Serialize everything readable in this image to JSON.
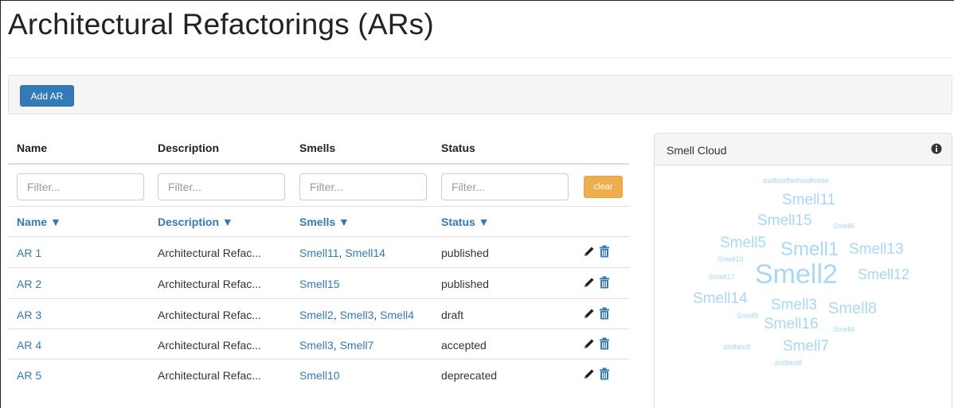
{
  "page": {
    "title": "Architectural Refactorings (ARs)"
  },
  "toolbar": {
    "add_label": "Add AR"
  },
  "table": {
    "headers": {
      "name": "Name",
      "description": "Description",
      "smells": "Smells",
      "status": "Status"
    },
    "filter_placeholder": "Filter...",
    "clear_label": "clear",
    "sort_labels": {
      "name": "Name ▼",
      "description": "Description ▼",
      "smells": "Smells ▼",
      "status": "Status ▼"
    },
    "rows": [
      {
        "name": "AR 1",
        "description": "Architectural Refac...",
        "smells": [
          "Smell11",
          "Smell14"
        ],
        "status": "published"
      },
      {
        "name": "AR 2",
        "description": "Architectural Refac...",
        "smells": [
          "Smell15"
        ],
        "status": "published"
      },
      {
        "name": "AR 3",
        "description": "Architectural Refac...",
        "smells": [
          "Smell2",
          "Smell3",
          "Smell4"
        ],
        "status": "draft"
      },
      {
        "name": "AR 4",
        "description": "Architectural Refac...",
        "smells": [
          "Smell3",
          "Smell7"
        ],
        "status": "accepted"
      },
      {
        "name": "AR 5",
        "description": "Architectural Refac...",
        "smells": [
          "Smell10"
        ],
        "status": "deprecated"
      }
    ]
  },
  "smell_cloud": {
    "title": "Smell Cloud",
    "words": [
      {
        "text": "asdfasdfasfasdfeeee",
        "size": 9
      },
      {
        "text": "Smell11",
        "size": 19
      },
      {
        "text": "Smell15",
        "size": 19
      },
      {
        "text": "Smell6",
        "size": 9
      },
      {
        "text": "Smell5",
        "size": 19
      },
      {
        "text": "Smell10",
        "size": 9
      },
      {
        "text": "Smell1",
        "size": 24
      },
      {
        "text": "Smell13",
        "size": 19
      },
      {
        "text": "Smell17",
        "size": 9
      },
      {
        "text": "Smell2",
        "size": 34
      },
      {
        "text": "Smell12",
        "size": 18
      },
      {
        "text": "Smell14",
        "size": 19
      },
      {
        "text": "Smell3",
        "size": 19
      },
      {
        "text": "Smell9",
        "size": 9
      },
      {
        "text": "Smell8",
        "size": 20
      },
      {
        "text": "Smell16",
        "size": 19
      },
      {
        "text": "Smell4",
        "size": 9
      },
      {
        "text": "asdfasdf",
        "size": 9
      },
      {
        "text": "Smell7",
        "size": 19
      },
      {
        "text": "asdfasdf",
        "size": 9
      }
    ]
  },
  "colors": {
    "primary": "#337ab7",
    "warning": "#f0ad4e",
    "cloud_word": "#a8d8f5"
  }
}
